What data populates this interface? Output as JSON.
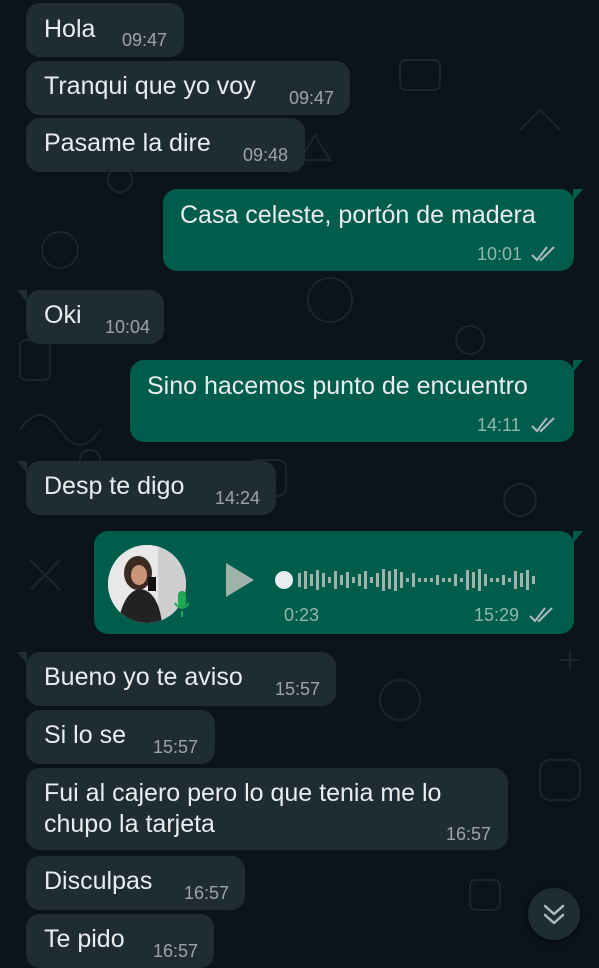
{
  "messages": [
    {
      "text": "Hola",
      "time": "09:47"
    },
    {
      "text": "Tranqui que yo voy",
      "time": "09:47"
    },
    {
      "text": "Pasame la dire",
      "time": "09:48"
    },
    {
      "text": "Casa celeste, portón de madera",
      "time": "10:01",
      "status": "read"
    },
    {
      "text": "Oki",
      "time": "10:04"
    },
    {
      "text": "Sino hacemos punto de encuentro",
      "time": "14:11",
      "status": "read"
    },
    {
      "text": "Desp te digo",
      "time": "14:24"
    },
    {
      "text": "Bueno yo te aviso",
      "time": "15:57"
    },
    {
      "text": "Si lo se",
      "time": "15:57"
    },
    {
      "text_line1": "Fui al cajero pero lo que tenia me lo",
      "text_line2": "chupo la tarjeta",
      "time": "16:57"
    },
    {
      "text": "Disculpas",
      "time": "16:57"
    },
    {
      "text": "Te pido",
      "time": "16:57"
    }
  ],
  "voice_message": {
    "duration": "0:23",
    "time": "15:29",
    "status": "read",
    "icons": [
      "sender-avatar",
      "mic-icon",
      "play-icon",
      "waveform",
      "double-check-icon"
    ]
  },
  "scroll_button": {
    "icon": "double-chevron-down-icon"
  },
  "colors": {
    "background": "#0b141a",
    "incoming_bubble": "#202c33",
    "outgoing_bubble": "#005c4b",
    "read_ticks": "#aebac1"
  }
}
